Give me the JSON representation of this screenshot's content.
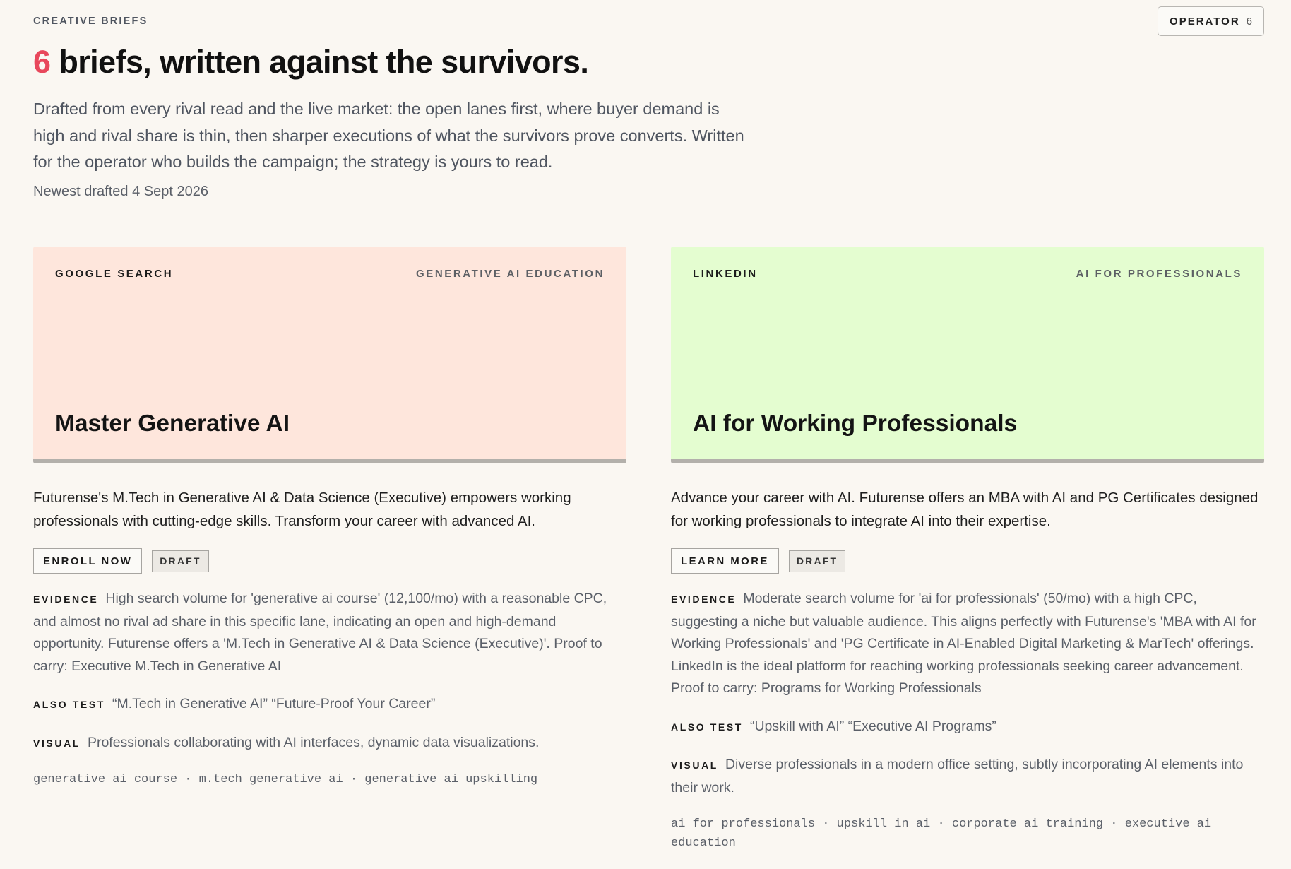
{
  "header": {
    "eyebrow": "CREATIVE BRIEFS",
    "operator_label": "OPERATOR",
    "operator_count": "6",
    "headline_count": "6",
    "headline_rest": " briefs, written against the survivors.",
    "lede": "Drafted from every rival read and the live market: the open lanes first, where buyer demand is high and rival share is thin, then sharper executions of what the survivors prove converts. Written for the operator who builds the campaign; the strategy is yours to read.",
    "drafted": "Newest drafted 4 Sept 2026"
  },
  "colors": {
    "accent": "#e8485c",
    "card_peach": "#fee6dc",
    "card_green": "#e4fdd0"
  },
  "labels": {
    "evidence": "EVIDENCE",
    "also_test": "ALSO TEST",
    "visual": "VISUAL"
  },
  "briefs": [
    {
      "platform": "GOOGLE SEARCH",
      "vertical": "GENERATIVE AI EDUCATION",
      "title": "Master Generative AI",
      "body": "Futurense's M.Tech in Generative AI & Data Science (Executive) empowers working professionals with cutting-edge skills. Transform your career with advanced AI.",
      "cta": "ENROLL NOW",
      "status": "DRAFT",
      "evidence": "High search volume for 'generative ai course' (12,100/mo) with a reasonable CPC, and almost no rival ad share in this specific lane, indicating an open and high-demand opportunity. Futurense offers a 'M.Tech in Generative AI & Data Science (Executive)'. Proof to carry: Executive M.Tech in Generative AI",
      "also_test": "“M.Tech in Generative AI” “Future-Proof Your Career”",
      "visual": "Professionals collaborating with AI interfaces, dynamic data visualizations.",
      "keywords": "generative ai course · m.tech generative ai · generative ai upskilling"
    },
    {
      "platform": "LINKEDIN",
      "vertical": "AI FOR PROFESSIONALS",
      "title": "AI for Working Professionals",
      "body": "Advance your career with AI. Futurense offers an MBA with AI and PG Certificates designed for working professionals to integrate AI into their expertise.",
      "cta": "LEARN MORE",
      "status": "DRAFT",
      "evidence": "Moderate search volume for 'ai for professionals' (50/mo) with a high CPC, suggesting a niche but valuable audience. This aligns perfectly with Futurense's 'MBA with AI for Working Professionals' and 'PG Certificate in AI-Enabled Digital Marketing & MarTech' offerings. LinkedIn is the ideal platform for reaching working professionals seeking career advancement. Proof to carry: Programs for Working Professionals",
      "also_test": "“Upskill with AI” “Executive AI Programs”",
      "visual": "Diverse professionals in a modern office setting, subtly incorporating AI elements into their work.",
      "keywords": "ai for professionals · upskill in ai · corporate ai training · executive ai education"
    }
  ]
}
